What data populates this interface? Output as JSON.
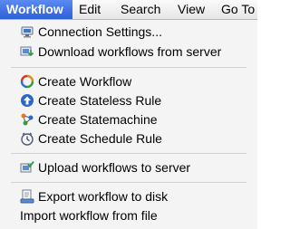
{
  "menubar": {
    "items": [
      {
        "label": "Workflow",
        "active": true
      },
      {
        "label": "Edit"
      },
      {
        "label": "Search"
      },
      {
        "label": "View"
      },
      {
        "label": "Go To"
      }
    ]
  },
  "menu": {
    "connection_settings": {
      "label": "Connection Settings...",
      "icon": "connection-settings-icon"
    },
    "download_workflows": {
      "label": "Download workflows from server",
      "icon": "download-icon"
    },
    "create_workflow": {
      "label": "Create Workflow",
      "icon": "create-workflow-icon"
    },
    "create_stateless_rule": {
      "label": "Create Stateless Rule",
      "icon": "stateless-rule-icon"
    },
    "create_statemachine": {
      "label": "Create Statemachine",
      "icon": "statemachine-icon"
    },
    "create_schedule_rule": {
      "label": "Create Schedule Rule",
      "icon": "clock-icon"
    },
    "upload_workflows": {
      "label": "Upload workflows to server",
      "icon": "upload-icon"
    },
    "export_workflow": {
      "label": "Export workflow to disk",
      "icon": "export-icon"
    },
    "import_workflow": {
      "label": "Import workflow from file"
    }
  },
  "colors": {
    "menu_highlight": "#2c5fd9",
    "menu_background": "#f4f4f4"
  }
}
